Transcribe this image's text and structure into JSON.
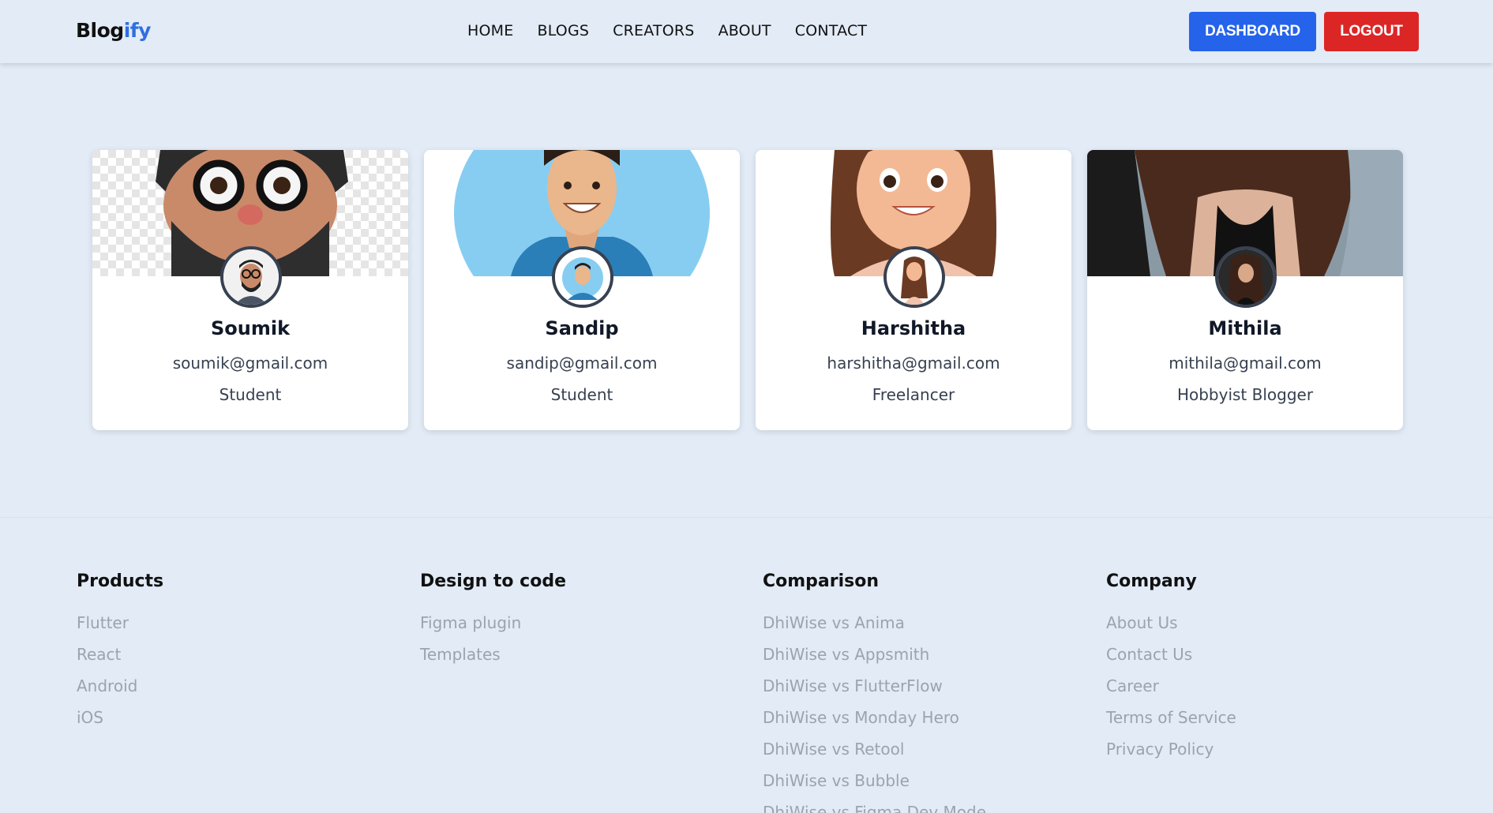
{
  "header": {
    "logo_main": "Blog",
    "logo_accent": "ify",
    "nav": [
      "HOME",
      "BLOGS",
      "CREATORS",
      "ABOUT",
      "CONTACT"
    ],
    "dashboard_label": "DASHBOARD",
    "logout_label": "LOGOUT"
  },
  "creators": [
    {
      "name": "Soumik",
      "email": "soumik@gmail.com",
      "role": "Student"
    },
    {
      "name": "Sandip",
      "email": "sandip@gmail.com",
      "role": "Student"
    },
    {
      "name": "Harshitha",
      "email": "harshitha@gmail.com",
      "role": "Freelancer"
    },
    {
      "name": "Mithila",
      "email": "mithila@gmail.com",
      "role": "Hobbyist Blogger"
    }
  ],
  "footer": {
    "columns": [
      {
        "title": "Products",
        "links": [
          "Flutter",
          "React",
          "Android",
          "iOS"
        ]
      },
      {
        "title": "Design to code",
        "links": [
          "Figma plugin",
          "Templates"
        ]
      },
      {
        "title": "Comparison",
        "links": [
          "DhiWise vs Anima",
          "DhiWise vs Appsmith",
          "DhiWise vs FlutterFlow",
          "DhiWise vs Monday Hero",
          "DhiWise vs Retool",
          "DhiWise vs Bubble",
          "DhiWise vs Figma Dev Mode"
        ]
      },
      {
        "title": "Company",
        "links": [
          "About Us",
          "Contact Us",
          "Career",
          "Terms of Service",
          "Privacy Policy"
        ]
      }
    ]
  }
}
